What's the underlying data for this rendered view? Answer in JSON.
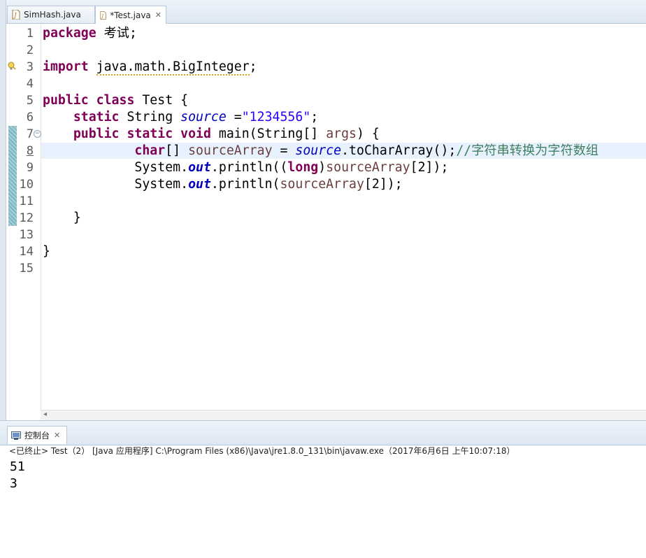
{
  "tabs": [
    {
      "label": "SimHash.java",
      "active": false
    },
    {
      "label": "*Test.java",
      "active": true
    }
  ],
  "line_numbers": [
    "1",
    "2",
    "3",
    "4",
    "5",
    "6",
    "7",
    "8",
    "9",
    "10",
    "11",
    "12",
    "13",
    "14",
    "15"
  ],
  "code": {
    "l1": {
      "kw": "package",
      "rest": " 考试;"
    },
    "l3": {
      "kw": "import",
      "pkg": "java.math.BigInteger",
      "end": ";"
    },
    "l5": {
      "kw1": "public",
      "kw2": "class",
      "rest": " Test {"
    },
    "l6": {
      "kw": "static",
      "type": " String ",
      "field": "source",
      "eq": " =",
      "str": "\"1234556\"",
      "end": ";"
    },
    "l7": {
      "kw1": "public",
      "kw2": "static",
      "kw3": "void",
      "rest": " main(String[] ",
      "param": "args",
      "end": ") {"
    },
    "l8": {
      "kw": "char",
      "arr": "[] ",
      "var": "sourceArray",
      "eq": " = ",
      "field": "source",
      "call": ".toCharArray();",
      "comment": "//字符串转换为字符数组"
    },
    "l9": {
      "a": "System.",
      "out": "out",
      "b": ".println((",
      "kw": "long",
      "c": ")",
      "var": "sourceArray",
      "d": "[2]);"
    },
    "l10": {
      "a": "System.",
      "out": "out",
      "b": ".println(",
      "var": "sourceArray",
      "d": "[2]);"
    },
    "l12": {
      "text": "}"
    },
    "l14": {
      "text": "}"
    }
  },
  "console": {
    "tab_label": "控制台",
    "status": "<已终止> Test（2） [Java 应用程序] C:\\Program Files (x86)\\Java\\jre1.8.0_131\\bin\\javaw.exe（2017年6月6日 上午10:07:18）",
    "output": [
      "51",
      "3"
    ]
  },
  "colors": {
    "keyword": "#7f0055",
    "string": "#2a00ff",
    "field": "#0000c0",
    "variable": "#6a3e3e",
    "comment": "#3f7f5f",
    "current_line": "#e8f2fe"
  }
}
